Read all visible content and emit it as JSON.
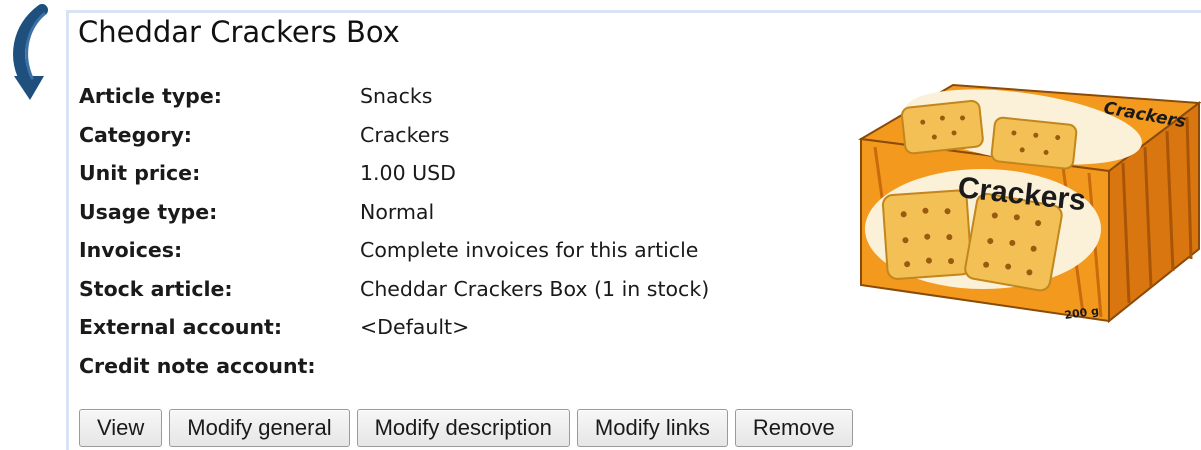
{
  "article": {
    "title": "Cheddar Crackers Box"
  },
  "properties": [
    {
      "label": "Article type:",
      "value": "Snacks"
    },
    {
      "label": "Category:",
      "value": "Crackers"
    },
    {
      "label": "Unit price:",
      "value": "1.00 USD"
    },
    {
      "label": "Usage type:",
      "value": "Normal"
    },
    {
      "label": "Invoices:",
      "value": "Complete invoices for this article"
    },
    {
      "label": "Stock article:",
      "value": "Cheddar Crackers Box (1 in stock)"
    },
    {
      "label": "External account:",
      "value": "<Default>"
    },
    {
      "label": "Credit note account:",
      "value": ""
    }
  ],
  "image": {
    "box_text": "Crackers",
    "lid_text": "Crackers",
    "weight": "200 g",
    "colors": {
      "orange": "#f39a1e",
      "dark_orange": "#c96a0c",
      "cream": "#fbf1d8",
      "cracker": "#f2c055"
    }
  },
  "buttons": [
    {
      "label": "View"
    },
    {
      "label": "Modify general"
    },
    {
      "label": "Modify description"
    },
    {
      "label": "Modify links"
    },
    {
      "label": "Remove"
    }
  ]
}
